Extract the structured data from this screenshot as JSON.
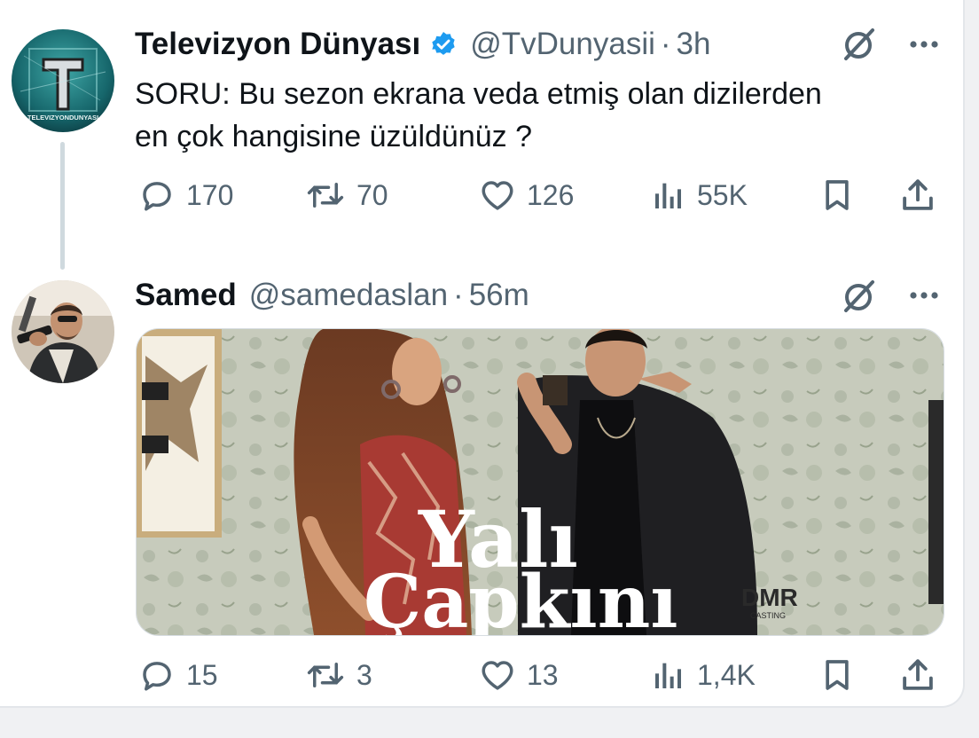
{
  "tweets": [
    {
      "display_name": "Televizyon Dünyası",
      "verified": true,
      "handle": "@TvDunyasii",
      "separator": "·",
      "time": "3h",
      "text_line1": "SORU: Bu sezon ekrana veda etmiş olan dizilerden",
      "text_line2": "en çok hangisine üzüldünüz ?",
      "avatar_text": "TELEVIZYONDUNYASI",
      "stats": {
        "replies": "170",
        "retweets": "70",
        "likes": "126",
        "views": "55K"
      }
    },
    {
      "display_name": "Samed",
      "verified": false,
      "handle": "@samedaslan",
      "separator": "·",
      "time": "56m",
      "image": {
        "title_line1": "Yalı",
        "title_line2": "Çapkını",
        "brand": "DMR",
        "brand_sub": "CASTING"
      },
      "stats": {
        "replies": "15",
        "retweets": "3",
        "likes": "13",
        "views": "1,4K"
      }
    }
  ],
  "icons": {
    "reply": "reply-icon",
    "retweet": "retweet-icon",
    "like": "like-icon",
    "views": "views-icon",
    "bookmark": "bookmark-icon",
    "share": "share-icon",
    "grok": "grok-icon",
    "more": "more-icon",
    "verified": "verified-badge-icon"
  },
  "colors": {
    "verified_blue": "#1d9bf0",
    "muted": "#536471",
    "text": "#0f1419",
    "thread_line": "#cfd9de"
  }
}
